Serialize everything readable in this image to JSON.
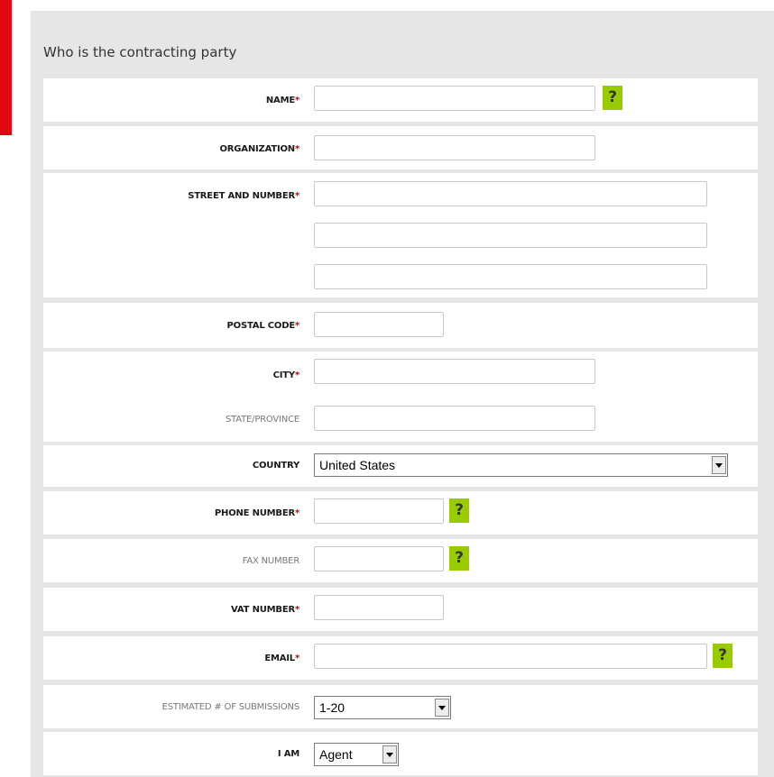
{
  "form": {
    "heading": "Who is the contracting party",
    "required_marker": "*",
    "help_icon_text": "?",
    "fields": {
      "name": {
        "label": "NAME"
      },
      "organization": {
        "label": "ORGANIZATION"
      },
      "street": {
        "label": "STREET AND NUMBER"
      },
      "postal": {
        "label": "POSTAL CODE"
      },
      "city": {
        "label": "CITY"
      },
      "state": {
        "label": "STATE/PROVINCE"
      },
      "country": {
        "label": "COUNTRY",
        "value": "United States"
      },
      "phone": {
        "label": "PHONE NUMBER"
      },
      "fax": {
        "label": "FAX NUMBER"
      },
      "vat": {
        "label": "VAT NUMBER"
      },
      "email": {
        "label": "EMAIL"
      },
      "submissions": {
        "label": "ESTIMATED # OF SUBMISSIONS",
        "value": "1-20"
      },
      "iam": {
        "label": "I AM",
        "value": "Agent"
      }
    }
  },
  "colors": {
    "accent": "#e30613",
    "help": "#99cc00",
    "required": "#cc0000",
    "panel": "#e6e6e6"
  }
}
